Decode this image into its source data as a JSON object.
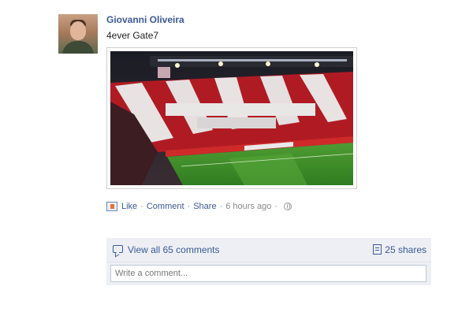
{
  "post": {
    "author": "Giovanni Oliveira",
    "status_text": "4ever Gate7",
    "actions": {
      "like": "Like",
      "comment": "Comment",
      "share": "Share",
      "time": "6 hours ago"
    }
  },
  "comments_panel": {
    "view_all": "View all 65 comments",
    "shares": "25 shares",
    "comment_placeholder": "Write a comment..."
  },
  "icons": {
    "like": "like-icon",
    "privacy": "globe-icon",
    "comments": "comment-bubble-icon",
    "shares": "share-document-icon"
  },
  "colors": {
    "link": "#3b5998",
    "panel_bg": "#edeff4",
    "input_border": "#bdc7d8"
  }
}
